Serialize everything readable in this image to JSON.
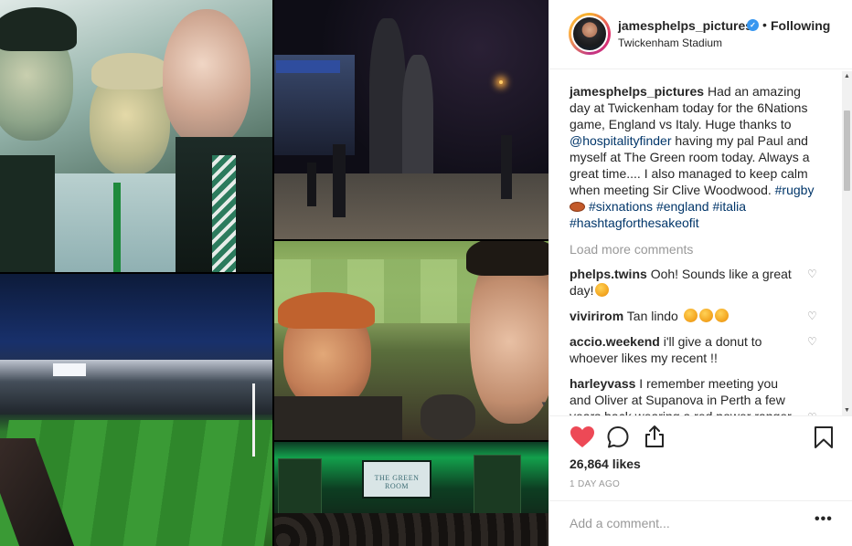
{
  "header": {
    "username": "jamesphelps_pictures",
    "verified_icon": "verified-check-icon",
    "separator": "•",
    "follow_status": "Following",
    "location": "Twickenham Stadium"
  },
  "caption": {
    "username": "jamesphelps_pictures",
    "text_1": "Had an amazing day at Twickenham today for the 6Nations game, England vs Italy. Huge thanks to",
    "mention": "@hospitalityfinder",
    "text_2": "having my pal Paul and myself at The Green room today. Always a great time.... I also managed to keep calm when meeting Sir Clive Woodwood.",
    "hashtag_rugby": "#rugby",
    "emoji_icon": "rugby-ball-icon",
    "hashtag_sixnations": "#sixnations",
    "hashtag_england": "#england",
    "hashtag_italia": "#italia",
    "hashtag_last": "#hashtagforthesakeofit"
  },
  "load_more": "Load more comments",
  "comments": [
    {
      "username": "phelps.twins",
      "text": "Ooh! Sounds like a great day!"
    },
    {
      "username": "vivirirom",
      "text": "Tan lindo"
    },
    {
      "username": "accio.weekend",
      "text": "i'll give a donut to whoever likes my recent !!"
    },
    {
      "username": "harleyvass",
      "text": "I remember meeting you and Oliver at Supanova in Perth a few years back wearing a red power ranger morph suit, and you told me you"
    }
  ],
  "collage": {
    "sign_text": "THE GREEN ROOM"
  },
  "actions": {
    "likes": "26,864 likes",
    "timestamp": "1 DAY AGO"
  },
  "add_comment": {
    "placeholder": "Add a comment...",
    "more_label": "•••"
  },
  "colors": {
    "heart": "#ed4956",
    "link": "#003569",
    "verified": "#3897f0",
    "muted": "#999999"
  }
}
